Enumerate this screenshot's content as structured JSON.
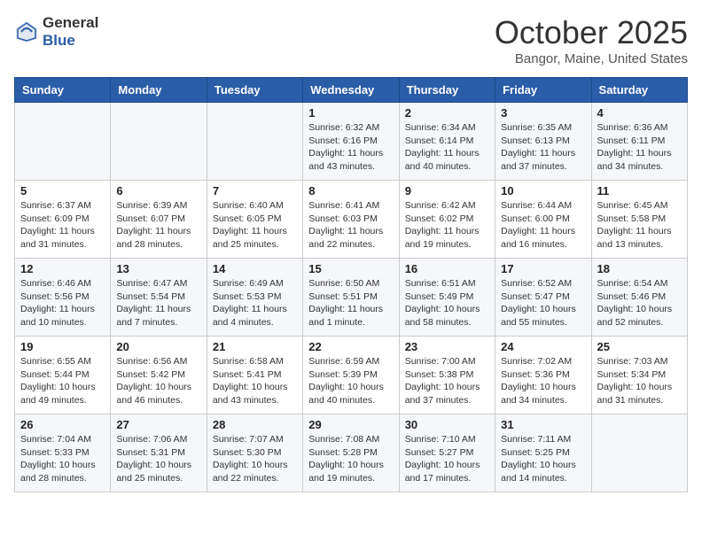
{
  "logo": {
    "general": "General",
    "blue": "Blue"
  },
  "header": {
    "month": "October 2025",
    "location": "Bangor, Maine, United States"
  },
  "weekdays": [
    "Sunday",
    "Monday",
    "Tuesday",
    "Wednesday",
    "Thursday",
    "Friday",
    "Saturday"
  ],
  "weeks": [
    [
      {
        "day": "",
        "sunrise": "",
        "sunset": "",
        "daylight": ""
      },
      {
        "day": "",
        "sunrise": "",
        "sunset": "",
        "daylight": ""
      },
      {
        "day": "",
        "sunrise": "",
        "sunset": "",
        "daylight": ""
      },
      {
        "day": "1",
        "sunrise": "Sunrise: 6:32 AM",
        "sunset": "Sunset: 6:16 PM",
        "daylight": "Daylight: 11 hours and 43 minutes."
      },
      {
        "day": "2",
        "sunrise": "Sunrise: 6:34 AM",
        "sunset": "Sunset: 6:14 PM",
        "daylight": "Daylight: 11 hours and 40 minutes."
      },
      {
        "day": "3",
        "sunrise": "Sunrise: 6:35 AM",
        "sunset": "Sunset: 6:13 PM",
        "daylight": "Daylight: 11 hours and 37 minutes."
      },
      {
        "day": "4",
        "sunrise": "Sunrise: 6:36 AM",
        "sunset": "Sunset: 6:11 PM",
        "daylight": "Daylight: 11 hours and 34 minutes."
      }
    ],
    [
      {
        "day": "5",
        "sunrise": "Sunrise: 6:37 AM",
        "sunset": "Sunset: 6:09 PM",
        "daylight": "Daylight: 11 hours and 31 minutes."
      },
      {
        "day": "6",
        "sunrise": "Sunrise: 6:39 AM",
        "sunset": "Sunset: 6:07 PM",
        "daylight": "Daylight: 11 hours and 28 minutes."
      },
      {
        "day": "7",
        "sunrise": "Sunrise: 6:40 AM",
        "sunset": "Sunset: 6:05 PM",
        "daylight": "Daylight: 11 hours and 25 minutes."
      },
      {
        "day": "8",
        "sunrise": "Sunrise: 6:41 AM",
        "sunset": "Sunset: 6:03 PM",
        "daylight": "Daylight: 11 hours and 22 minutes."
      },
      {
        "day": "9",
        "sunrise": "Sunrise: 6:42 AM",
        "sunset": "Sunset: 6:02 PM",
        "daylight": "Daylight: 11 hours and 19 minutes."
      },
      {
        "day": "10",
        "sunrise": "Sunrise: 6:44 AM",
        "sunset": "Sunset: 6:00 PM",
        "daylight": "Daylight: 11 hours and 16 minutes."
      },
      {
        "day": "11",
        "sunrise": "Sunrise: 6:45 AM",
        "sunset": "Sunset: 5:58 PM",
        "daylight": "Daylight: 11 hours and 13 minutes."
      }
    ],
    [
      {
        "day": "12",
        "sunrise": "Sunrise: 6:46 AM",
        "sunset": "Sunset: 5:56 PM",
        "daylight": "Daylight: 11 hours and 10 minutes."
      },
      {
        "day": "13",
        "sunrise": "Sunrise: 6:47 AM",
        "sunset": "Sunset: 5:54 PM",
        "daylight": "Daylight: 11 hours and 7 minutes."
      },
      {
        "day": "14",
        "sunrise": "Sunrise: 6:49 AM",
        "sunset": "Sunset: 5:53 PM",
        "daylight": "Daylight: 11 hours and 4 minutes."
      },
      {
        "day": "15",
        "sunrise": "Sunrise: 6:50 AM",
        "sunset": "Sunset: 5:51 PM",
        "daylight": "Daylight: 11 hours and 1 minute."
      },
      {
        "day": "16",
        "sunrise": "Sunrise: 6:51 AM",
        "sunset": "Sunset: 5:49 PM",
        "daylight": "Daylight: 10 hours and 58 minutes."
      },
      {
        "day": "17",
        "sunrise": "Sunrise: 6:52 AM",
        "sunset": "Sunset: 5:47 PM",
        "daylight": "Daylight: 10 hours and 55 minutes."
      },
      {
        "day": "18",
        "sunrise": "Sunrise: 6:54 AM",
        "sunset": "Sunset: 5:46 PM",
        "daylight": "Daylight: 10 hours and 52 minutes."
      }
    ],
    [
      {
        "day": "19",
        "sunrise": "Sunrise: 6:55 AM",
        "sunset": "Sunset: 5:44 PM",
        "daylight": "Daylight: 10 hours and 49 minutes."
      },
      {
        "day": "20",
        "sunrise": "Sunrise: 6:56 AM",
        "sunset": "Sunset: 5:42 PM",
        "daylight": "Daylight: 10 hours and 46 minutes."
      },
      {
        "day": "21",
        "sunrise": "Sunrise: 6:58 AM",
        "sunset": "Sunset: 5:41 PM",
        "daylight": "Daylight: 10 hours and 43 minutes."
      },
      {
        "day": "22",
        "sunrise": "Sunrise: 6:59 AM",
        "sunset": "Sunset: 5:39 PM",
        "daylight": "Daylight: 10 hours and 40 minutes."
      },
      {
        "day": "23",
        "sunrise": "Sunrise: 7:00 AM",
        "sunset": "Sunset: 5:38 PM",
        "daylight": "Daylight: 10 hours and 37 minutes."
      },
      {
        "day": "24",
        "sunrise": "Sunrise: 7:02 AM",
        "sunset": "Sunset: 5:36 PM",
        "daylight": "Daylight: 10 hours and 34 minutes."
      },
      {
        "day": "25",
        "sunrise": "Sunrise: 7:03 AM",
        "sunset": "Sunset: 5:34 PM",
        "daylight": "Daylight: 10 hours and 31 minutes."
      }
    ],
    [
      {
        "day": "26",
        "sunrise": "Sunrise: 7:04 AM",
        "sunset": "Sunset: 5:33 PM",
        "daylight": "Daylight: 10 hours and 28 minutes."
      },
      {
        "day": "27",
        "sunrise": "Sunrise: 7:06 AM",
        "sunset": "Sunset: 5:31 PM",
        "daylight": "Daylight: 10 hours and 25 minutes."
      },
      {
        "day": "28",
        "sunrise": "Sunrise: 7:07 AM",
        "sunset": "Sunset: 5:30 PM",
        "daylight": "Daylight: 10 hours and 22 minutes."
      },
      {
        "day": "29",
        "sunrise": "Sunrise: 7:08 AM",
        "sunset": "Sunset: 5:28 PM",
        "daylight": "Daylight: 10 hours and 19 minutes."
      },
      {
        "day": "30",
        "sunrise": "Sunrise: 7:10 AM",
        "sunset": "Sunset: 5:27 PM",
        "daylight": "Daylight: 10 hours and 17 minutes."
      },
      {
        "day": "31",
        "sunrise": "Sunrise: 7:11 AM",
        "sunset": "Sunset: 5:25 PM",
        "daylight": "Daylight: 10 hours and 14 minutes."
      },
      {
        "day": "",
        "sunrise": "",
        "sunset": "",
        "daylight": ""
      }
    ]
  ]
}
